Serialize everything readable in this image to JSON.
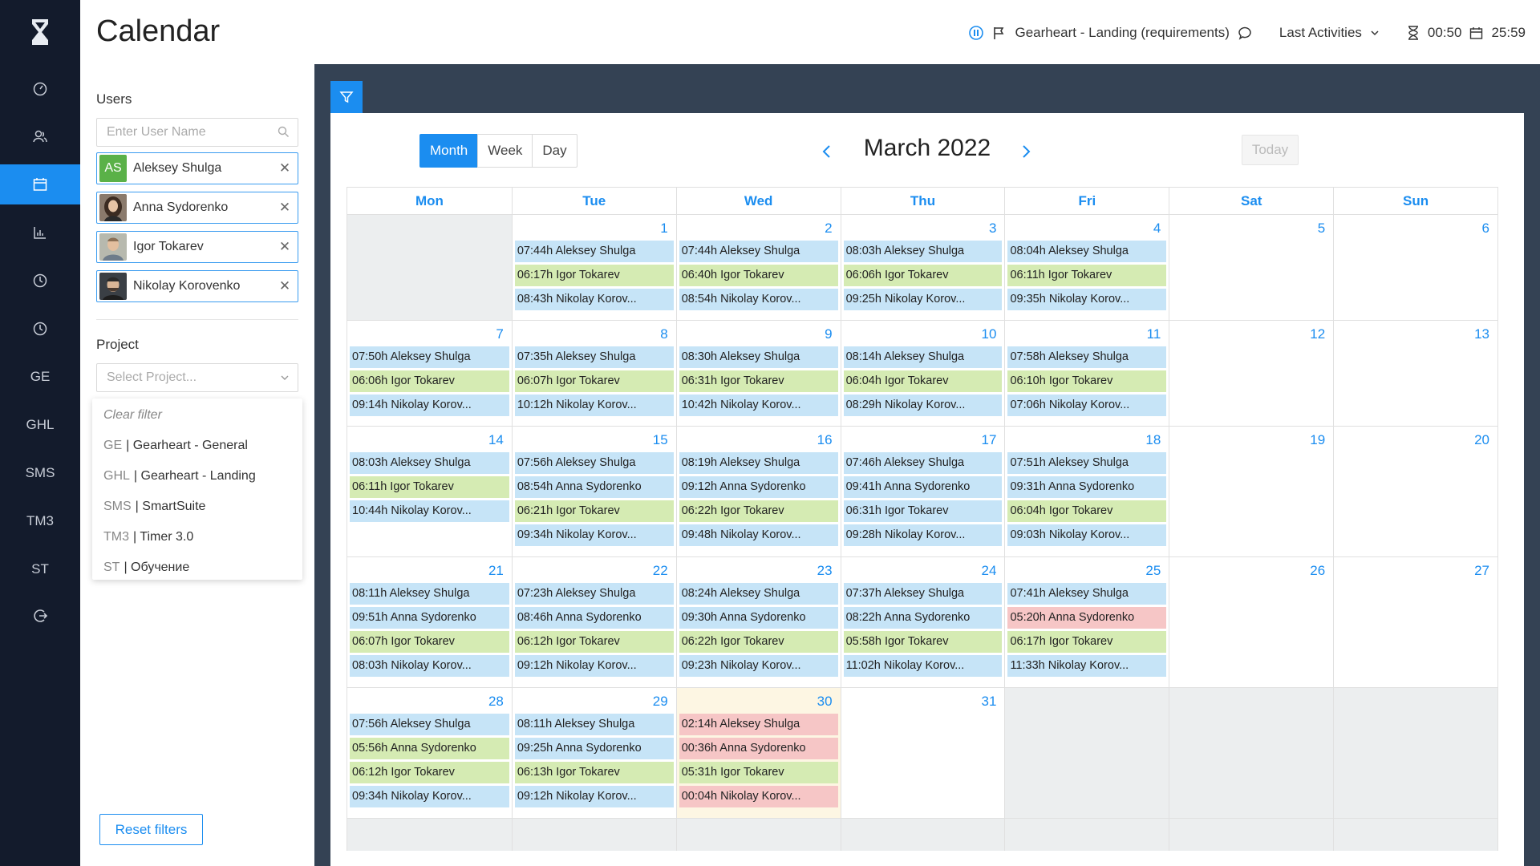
{
  "app": {
    "title": "Calendar"
  },
  "sidebar": {
    "items": [
      {
        "name": "dashboard-icon",
        "label": ""
      },
      {
        "name": "users-icon",
        "label": ""
      },
      {
        "name": "calendar-icon",
        "label": "",
        "active": true
      },
      {
        "name": "reports-icon",
        "label": ""
      },
      {
        "name": "clock-icon",
        "label": ""
      },
      {
        "name": "history-icon",
        "label": ""
      },
      {
        "name": "project-ge",
        "label": "GE"
      },
      {
        "name": "project-ghl",
        "label": "GHL"
      },
      {
        "name": "project-sms",
        "label": "SMS"
      },
      {
        "name": "project-tm3",
        "label": "TM3"
      },
      {
        "name": "project-st",
        "label": "ST"
      },
      {
        "name": "logout-icon",
        "label": ""
      }
    ]
  },
  "header": {
    "current_task": "Gearheart - Landing (requirements)",
    "last_activities": "Last Activities",
    "timer": "00:50",
    "daily_total": "25:59"
  },
  "filters": {
    "users_label": "Users",
    "user_search_placeholder": "Enter User Name",
    "users": [
      {
        "name": "Aleksey Shulga",
        "initials": "AS"
      },
      {
        "name": "Anna Sydorenko",
        "initials": ""
      },
      {
        "name": "Igor Tokarev",
        "initials": ""
      },
      {
        "name": "Nikolay Korovenko",
        "initials": ""
      }
    ],
    "project_label": "Project",
    "project_placeholder": "Select Project...",
    "project_options": [
      {
        "code": "",
        "name": "Clear filter"
      },
      {
        "code": "GE",
        "name": "| Gearheart - General"
      },
      {
        "code": "GHL",
        "name": "| Gearheart - Landing"
      },
      {
        "code": "SMS",
        "name": "| SmartSuite"
      },
      {
        "code": "TM3",
        "name": "| Timer 3.0"
      },
      {
        "code": "ST",
        "name": "| Обучение"
      }
    ],
    "reset_label": "Reset filters"
  },
  "calendar": {
    "views": [
      "Month",
      "Week",
      "Day"
    ],
    "active_view": "Month",
    "title": "March 2022",
    "today_label": "Today",
    "day_headers": [
      "Mon",
      "Tue",
      "Wed",
      "Thu",
      "Fri",
      "Sat",
      "Sun"
    ],
    "weeks": [
      [
        {
          "day": "",
          "outside": true,
          "events": []
        },
        {
          "day": "1",
          "events": [
            {
              "t": "07:44h Aleksey Shulga",
              "c": "blue"
            },
            {
              "t": "06:17h Igor Tokarev",
              "c": "green"
            },
            {
              "t": "08:43h Nikolay Korov...",
              "c": "blue"
            }
          ]
        },
        {
          "day": "2",
          "events": [
            {
              "t": "07:44h Aleksey Shulga",
              "c": "blue"
            },
            {
              "t": "06:40h Igor Tokarev",
              "c": "green"
            },
            {
              "t": "08:54h Nikolay Korov...",
              "c": "blue"
            }
          ]
        },
        {
          "day": "3",
          "events": [
            {
              "t": "08:03h Aleksey Shulga",
              "c": "blue"
            },
            {
              "t": "06:06h Igor Tokarev",
              "c": "green"
            },
            {
              "t": "09:25h Nikolay Korov...",
              "c": "blue"
            }
          ]
        },
        {
          "day": "4",
          "events": [
            {
              "t": "08:04h Aleksey Shulga",
              "c": "blue"
            },
            {
              "t": "06:11h Igor Tokarev",
              "c": "green"
            },
            {
              "t": "09:35h Nikolay Korov...",
              "c": "blue"
            }
          ]
        },
        {
          "day": "5",
          "events": []
        },
        {
          "day": "6",
          "events": []
        }
      ],
      [
        {
          "day": "7",
          "events": [
            {
              "t": "07:50h Aleksey Shulga",
              "c": "blue"
            },
            {
              "t": "06:06h Igor Tokarev",
              "c": "green"
            },
            {
              "t": "09:14h Nikolay Korov...",
              "c": "blue"
            }
          ]
        },
        {
          "day": "8",
          "events": [
            {
              "t": "07:35h Aleksey Shulga",
              "c": "blue"
            },
            {
              "t": "06:07h Igor Tokarev",
              "c": "green"
            },
            {
              "t": "10:12h Nikolay Korov...",
              "c": "blue"
            }
          ]
        },
        {
          "day": "9",
          "events": [
            {
              "t": "08:30h Aleksey Shulga",
              "c": "blue"
            },
            {
              "t": "06:31h Igor Tokarev",
              "c": "green"
            },
            {
              "t": "10:42h Nikolay Korov...",
              "c": "blue"
            }
          ]
        },
        {
          "day": "10",
          "events": [
            {
              "t": "08:14h Aleksey Shulga",
              "c": "blue"
            },
            {
              "t": "06:04h Igor Tokarev",
              "c": "green"
            },
            {
              "t": "08:29h Nikolay Korov...",
              "c": "blue"
            }
          ]
        },
        {
          "day": "11",
          "events": [
            {
              "t": "07:58h Aleksey Shulga",
              "c": "blue"
            },
            {
              "t": "06:10h Igor Tokarev",
              "c": "green"
            },
            {
              "t": "07:06h Nikolay Korov...",
              "c": "blue"
            }
          ]
        },
        {
          "day": "12",
          "events": []
        },
        {
          "day": "13",
          "events": []
        }
      ],
      [
        {
          "day": "14",
          "events": [
            {
              "t": "08:03h Aleksey Shulga",
              "c": "blue"
            },
            {
              "t": "06:11h Igor Tokarev",
              "c": "green"
            },
            {
              "t": "10:44h Nikolay Korov...",
              "c": "blue"
            }
          ]
        },
        {
          "day": "15",
          "events": [
            {
              "t": "07:56h Aleksey Shulga",
              "c": "blue"
            },
            {
              "t": "08:54h Anna Sydorenko",
              "c": "blue"
            },
            {
              "t": "06:21h Igor Tokarev",
              "c": "green"
            },
            {
              "t": "09:34h Nikolay Korov...",
              "c": "blue"
            }
          ]
        },
        {
          "day": "16",
          "events": [
            {
              "t": "08:19h Aleksey Shulga",
              "c": "blue"
            },
            {
              "t": "09:12h Anna Sydorenko",
              "c": "blue"
            },
            {
              "t": "06:22h Igor Tokarev",
              "c": "green"
            },
            {
              "t": "09:48h Nikolay Korov...",
              "c": "blue"
            }
          ]
        },
        {
          "day": "17",
          "events": [
            {
              "t": "07:46h Aleksey Shulga",
              "c": "blue"
            },
            {
              "t": "09:41h Anna Sydorenko",
              "c": "blue"
            },
            {
              "t": "06:31h Igor Tokarev",
              "c": "blue"
            },
            {
              "t": "09:28h Nikolay Korov...",
              "c": "blue"
            }
          ]
        },
        {
          "day": "18",
          "events": [
            {
              "t": "07:51h Aleksey Shulga",
              "c": "blue"
            },
            {
              "t": "09:31h Anna Sydorenko",
              "c": "blue"
            },
            {
              "t": "06:04h Igor Tokarev",
              "c": "green"
            },
            {
              "t": "09:03h Nikolay Korov...",
              "c": "blue"
            }
          ]
        },
        {
          "day": "19",
          "events": []
        },
        {
          "day": "20",
          "events": []
        }
      ],
      [
        {
          "day": "21",
          "events": [
            {
              "t": "08:11h Aleksey Shulga",
              "c": "blue"
            },
            {
              "t": "09:51h Anna Sydorenko",
              "c": "blue"
            },
            {
              "t": "06:07h Igor Tokarev",
              "c": "green"
            },
            {
              "t": "08:03h Nikolay Korov...",
              "c": "blue"
            }
          ]
        },
        {
          "day": "22",
          "events": [
            {
              "t": "07:23h Aleksey Shulga",
              "c": "blue"
            },
            {
              "t": "08:46h Anna Sydorenko",
              "c": "blue"
            },
            {
              "t": "06:12h Igor Tokarev",
              "c": "green"
            },
            {
              "t": "09:12h Nikolay Korov...",
              "c": "blue"
            }
          ]
        },
        {
          "day": "23",
          "events": [
            {
              "t": "08:24h Aleksey Shulga",
              "c": "blue"
            },
            {
              "t": "09:30h Anna Sydorenko",
              "c": "blue"
            },
            {
              "t": "06:22h Igor Tokarev",
              "c": "green"
            },
            {
              "t": "09:23h Nikolay Korov...",
              "c": "blue"
            }
          ]
        },
        {
          "day": "24",
          "events": [
            {
              "t": "07:37h Aleksey Shulga",
              "c": "blue"
            },
            {
              "t": "08:22h Anna Sydorenko",
              "c": "blue"
            },
            {
              "t": "05:58h Igor Tokarev",
              "c": "green"
            },
            {
              "t": "11:02h Nikolay Korov...",
              "c": "blue"
            }
          ]
        },
        {
          "day": "25",
          "events": [
            {
              "t": "07:41h Aleksey Shulga",
              "c": "blue"
            },
            {
              "t": "05:20h Anna Sydorenko",
              "c": "red"
            },
            {
              "t": "06:17h Igor Tokarev",
              "c": "green"
            },
            {
              "t": "11:33h Nikolay Korov...",
              "c": "blue"
            }
          ]
        },
        {
          "day": "26",
          "events": []
        },
        {
          "day": "27",
          "events": []
        }
      ],
      [
        {
          "day": "28",
          "events": [
            {
              "t": "07:56h Aleksey Shulga",
              "c": "blue"
            },
            {
              "t": "05:56h Anna Sydorenko",
              "c": "green"
            },
            {
              "t": "06:12h Igor Tokarev",
              "c": "green"
            },
            {
              "t": "09:34h Nikolay Korov...",
              "c": "blue"
            }
          ]
        },
        {
          "day": "29",
          "events": [
            {
              "t": "08:11h Aleksey Shulga",
              "c": "blue"
            },
            {
              "t": "09:25h Anna Sydorenko",
              "c": "blue"
            },
            {
              "t": "06:13h Igor Tokarev",
              "c": "green"
            },
            {
              "t": "09:12h Nikolay Korov...",
              "c": "blue"
            }
          ]
        },
        {
          "day": "30",
          "today": true,
          "events": [
            {
              "t": "02:14h Aleksey Shulga",
              "c": "red"
            },
            {
              "t": "00:36h Anna Sydorenko",
              "c": "red"
            },
            {
              "t": "05:31h Igor Tokarev",
              "c": "green"
            },
            {
              "t": "00:04h Nikolay Korov...",
              "c": "red"
            }
          ]
        },
        {
          "day": "31",
          "events": []
        },
        {
          "day": "",
          "outside": true,
          "events": []
        },
        {
          "day": "",
          "outside": true,
          "events": []
        },
        {
          "day": "",
          "outside": true,
          "events": []
        }
      ]
    ]
  },
  "colors": {
    "accent": "#1b8df0",
    "sidebar_bg": "#131b2c",
    "main_bg": "#344254",
    "event_blue": "#c6e4f7",
    "event_green": "#d5ebb3",
    "event_red": "#f6c6c6"
  }
}
